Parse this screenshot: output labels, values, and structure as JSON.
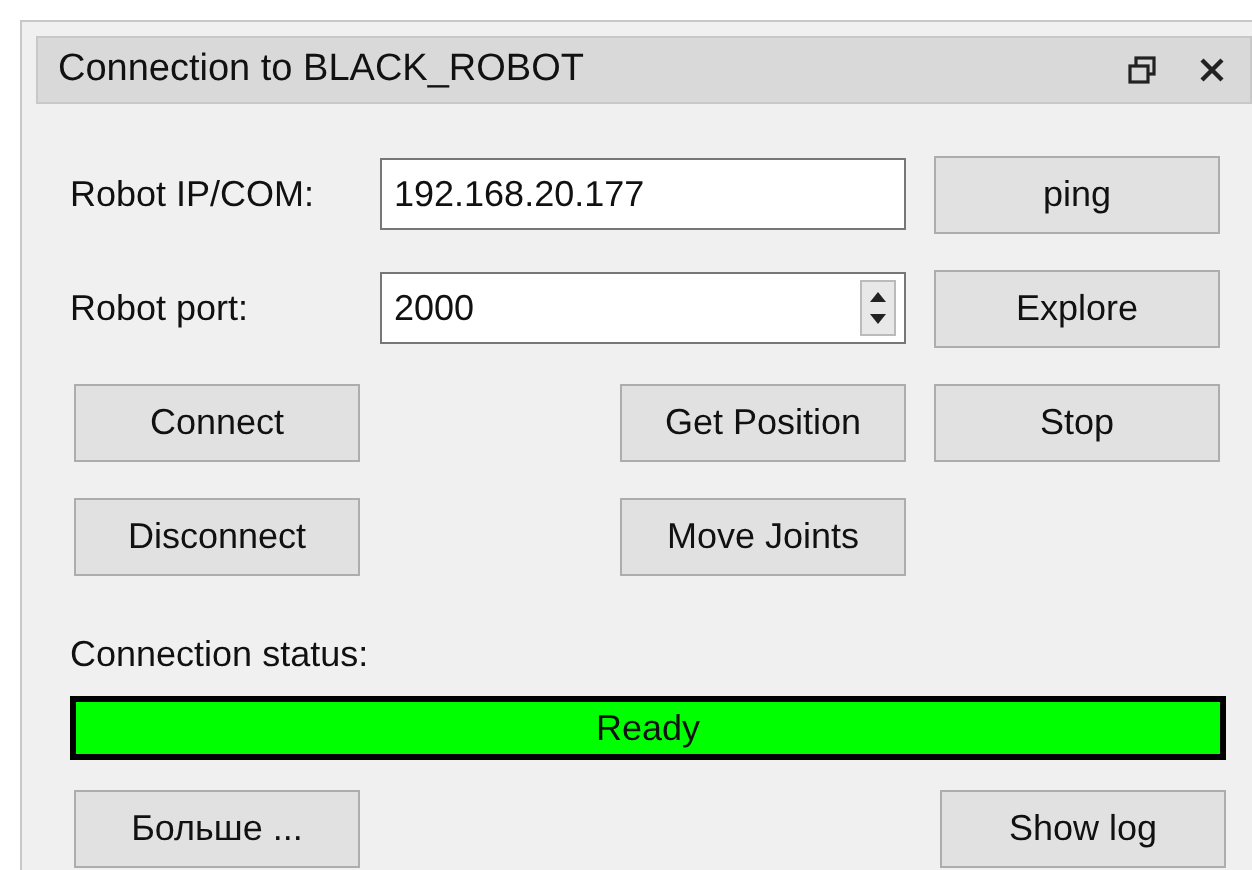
{
  "window": {
    "title": "Connection to BLACK_ROBOT"
  },
  "fields": [
    {
      "label": "Robot IP/COM:",
      "kind": "text",
      "value": "192.168.20.177",
      "button": "ping"
    },
    {
      "label": "Robot port:",
      "kind": "spin",
      "value": "2000",
      "button": "Explore"
    }
  ],
  "action_rows": [
    {
      "left": "Connect",
      "middle": "Get Position",
      "right": "Stop"
    },
    {
      "left": "Disconnect",
      "middle": "Move Joints"
    }
  ],
  "status_label": "Connection status:",
  "status": {
    "text": "Ready",
    "color": "#00ff00"
  },
  "footer": {
    "left": "Больше ...",
    "right": "Show log"
  }
}
